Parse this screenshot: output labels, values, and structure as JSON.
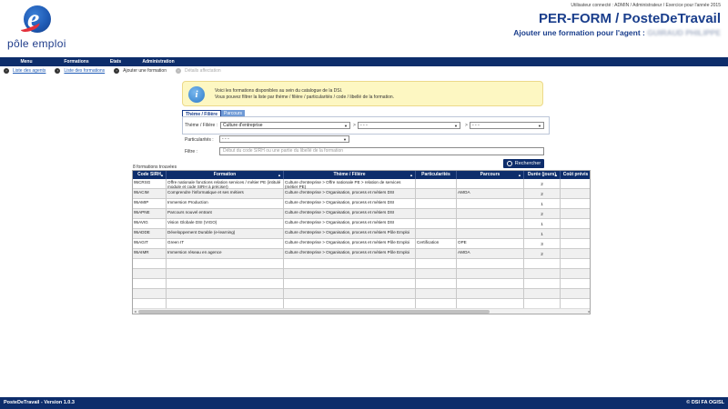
{
  "logo": {
    "text": "pôle emploi"
  },
  "header": {
    "user_info": "Utilisateur connecté : ADMIN / Administrateur / Exercice pour l'année 2015",
    "title": "PER-FORM / PosteDeTravail",
    "subtitle_prefix": "Ajouter une formation pour l'agent : ",
    "agent_name": "GUIRAUD PHILIPPE"
  },
  "nav": {
    "items": [
      {
        "label": "Menu"
      },
      {
        "label": "Formations"
      },
      {
        "label": "Etats"
      },
      {
        "label": "Administration"
      }
    ]
  },
  "breadcrumb": {
    "items": [
      {
        "label": "Liste des agents"
      },
      {
        "label": "Liste des formations"
      },
      {
        "label": "Ajouter une formation"
      },
      {
        "label": "Détails affectation"
      }
    ]
  },
  "info": {
    "icon": "info-icon",
    "line1": "Voici les formations disponibles au sein du catalogue de la DSI.",
    "line2": "Vous pouvez filtrer la liste par thème / filière / particularités / code / libellé de la formation."
  },
  "tabs": {
    "theme": "Thème / Filière",
    "parcours": "Parcours"
  },
  "filters": {
    "theme_label": "Thème / Filière :",
    "theme_value": "Culture d'entreprise",
    "sub1_value": "- - -",
    "sub2_value": "- - -",
    "separator": ">",
    "particularites_label": "Particularités :",
    "particularites_value": "- - -",
    "filtre_label": "Filtre :",
    "filtre_placeholder": "Début du code SIRH ou une partie du libellé de la formation"
  },
  "search": {
    "label": "Rechercher"
  },
  "results": {
    "count_text": "8 formations trouvées",
    "columns": [
      "Code SIRH",
      "Formation",
      "Thème / Filière",
      "Particularités",
      "Parcours",
      "Durée (jours)",
      "Coût prévis"
    ],
    "rows": [
      {
        "code": "95CRSG",
        "formation": "Offre nationale fonctions relation services / métier PE (intitulé module et code SIRH à préciser)",
        "theme": "Culture d'entreprise > Offre nationale PE > relation de services (métier PE)",
        "part": "",
        "parcours": "",
        "duree": "2",
        "cout": ""
      },
      {
        "code": "95ACIM",
        "formation": "Comprendre l'informatique et ses métiers",
        "theme": "Culture d'entreprise > Organisation, process et métiers DSI",
        "part": "",
        "parcours": "AMOA",
        "duree": "2",
        "cout": ""
      },
      {
        "code": "95AMIP",
        "formation": "Immersion Production",
        "theme": "Culture d'entreprise > Organisation, process et métiers DSI",
        "part": "",
        "parcours": "",
        "duree": "1",
        "cout": ""
      },
      {
        "code": "95APNE",
        "formation": "Parcours nouvel entrant",
        "theme": "Culture d'entreprise > Organisation, process et métiers DSI",
        "part": "",
        "parcours": "",
        "duree": "2",
        "cout": ""
      },
      {
        "code": "95AVIG",
        "formation": "Vision Globale DSI (VIGO)",
        "theme": "Culture d'entreprise > Organisation, process et métiers DSI",
        "part": "",
        "parcours": "",
        "duree": "1",
        "cout": ""
      },
      {
        "code": "95ADDE",
        "formation": "Développement Durable (e-learning)",
        "theme": "Culture d'entreprise > Organisation, process et métiers Pôle Emploi",
        "part": "",
        "parcours": "",
        "duree": "1",
        "cout": ""
      },
      {
        "code": "95AGIT",
        "formation": "Green IT",
        "theme": "Culture d'entreprise > Organisation, process et métiers Pôle Emploi",
        "part": "Certification",
        "parcours": "OPE",
        "duree": "3",
        "cout": ""
      },
      {
        "code": "95AIMR",
        "formation": "Immersion réseau en agence",
        "theme": "Culture d'entreprise > Organisation, process et métiers Pôle Emploi",
        "part": "",
        "parcours": "AMOA",
        "duree": "2",
        "cout": ""
      }
    ]
  },
  "footer": {
    "left": "PosteDeTravail - Version 1.0.3",
    "right": "© DSI FA OGISL"
  },
  "colors": {
    "navy": "#0d2d6b",
    "title_blue": "#1a3e8c",
    "info_bg": "#fdf7c2",
    "brand_red": "#e3303b"
  }
}
